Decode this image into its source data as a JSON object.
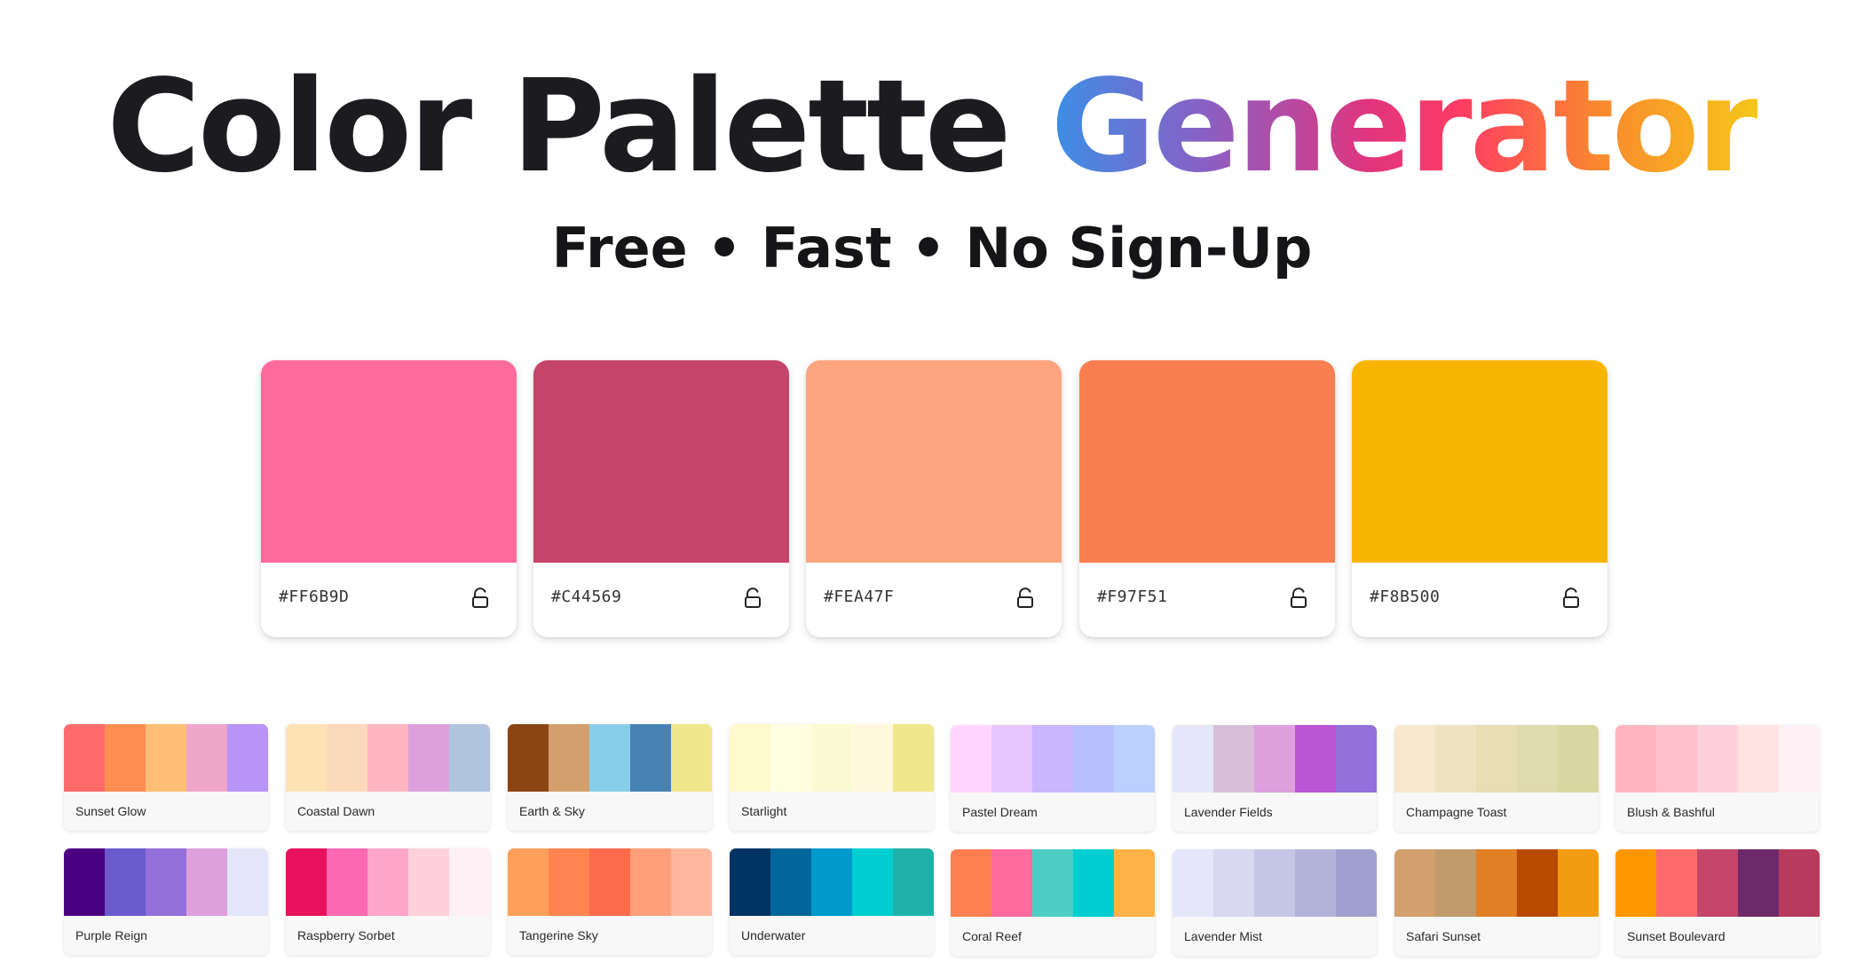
{
  "header": {
    "title_plain": "Color Palette ",
    "title_gradient": "Generator",
    "subtitle": "Free • Fast • No Sign-Up"
  },
  "palette": [
    {
      "hex": "#FF6B9D",
      "color": "#FF6B9D",
      "icon": "unlocked-padlock-icon"
    },
    {
      "hex": "#C44569",
      "color": "#C44569",
      "icon": "unlocked-padlock-icon"
    },
    {
      "hex": "#FEA47F",
      "color": "#FEA47F",
      "icon": "unlocked-padlock-icon"
    },
    {
      "hex": "#F97F51",
      "color": "#F97F51",
      "icon": "unlocked-padlock-icon"
    },
    {
      "hex": "#F8B500",
      "color": "#F8B500",
      "icon": "unlocked-padlock-icon"
    }
  ],
  "presets": [
    {
      "name": "Sunset Glow",
      "colors": [
        "#FF6B6B",
        "#FF8E53",
        "#FFBE76",
        "#F0A6CA",
        "#B794F6"
      ]
    },
    {
      "name": "Coastal Dawn",
      "colors": [
        "#FDE2B3",
        "#FDD9BC",
        "#FFB6C1",
        "#DDA0DD",
        "#B0C4DE"
      ]
    },
    {
      "name": "Earth & Sky",
      "colors": [
        "#8B4513",
        "#D2A06D",
        "#87CEEB",
        "#4682B4",
        "#F0E68C"
      ]
    },
    {
      "name": "Starlight",
      "colors": [
        "#FFFACD",
        "#FFFFE0",
        "#FAFAD2",
        "#FFF8DC",
        "#F0E68C"
      ]
    },
    {
      "name": "Pastel Dream",
      "colors": [
        "#FFD6FF",
        "#E7C6FF",
        "#C8B6FF",
        "#B8C0FF",
        "#BBD0FF"
      ]
    },
    {
      "name": "Lavender Fields",
      "colors": [
        "#E6E6FA",
        "#D8BFD8",
        "#DDA0DD",
        "#BA55D3",
        "#9370DB"
      ]
    },
    {
      "name": "Champagne Toast",
      "colors": [
        "#F7E7CE",
        "#EFE2C0",
        "#E8DEB5",
        "#E0DBAE",
        "#D9D6A1"
      ]
    },
    {
      "name": "Blush & Bashful",
      "colors": [
        "#FFB6C1",
        "#FFC0CB",
        "#FFD1DC",
        "#FFE4E1",
        "#FFF0F5"
      ]
    },
    {
      "name": "Purple Reign",
      "colors": [
        "#4B0082",
        "#6A5ACD",
        "#9370DB",
        "#DDA0DD",
        "#E6E6FA"
      ]
    },
    {
      "name": "Raspberry Sorbet",
      "colors": [
        "#E8125C",
        "#FF69B4",
        "#FFA6C9",
        "#FFD1DC",
        "#FFF0F5"
      ]
    },
    {
      "name": "Tangerine Sky",
      "colors": [
        "#FF9F5A",
        "#FF8450",
        "#FF6B4A",
        "#FFA07A",
        "#FFB89E"
      ]
    },
    {
      "name": "Underwater",
      "colors": [
        "#003366",
        "#006699",
        "#0099CC",
        "#00CED1",
        "#20B2AA"
      ]
    },
    {
      "name": "Coral Reef",
      "colors": [
        "#FF7F50",
        "#FF6B9D",
        "#4ECDC4",
        "#00CED1",
        "#FFB347"
      ]
    },
    {
      "name": "Lavender Mist",
      "colors": [
        "#E6E6FA",
        "#D8D8F0",
        "#C5C5E5",
        "#B3B3DA",
        "#A0A0D0"
      ]
    },
    {
      "name": "Safari Sunset",
      "colors": [
        "#D2A06D",
        "#C19A6B",
        "#E07F24",
        "#B84A00",
        "#F39C12"
      ]
    },
    {
      "name": "Sunset Boulevard",
      "colors": [
        "#FF9800",
        "#FF6B6B",
        "#C44569",
        "#6C2A6A",
        "#B83B5E"
      ]
    }
  ]
}
